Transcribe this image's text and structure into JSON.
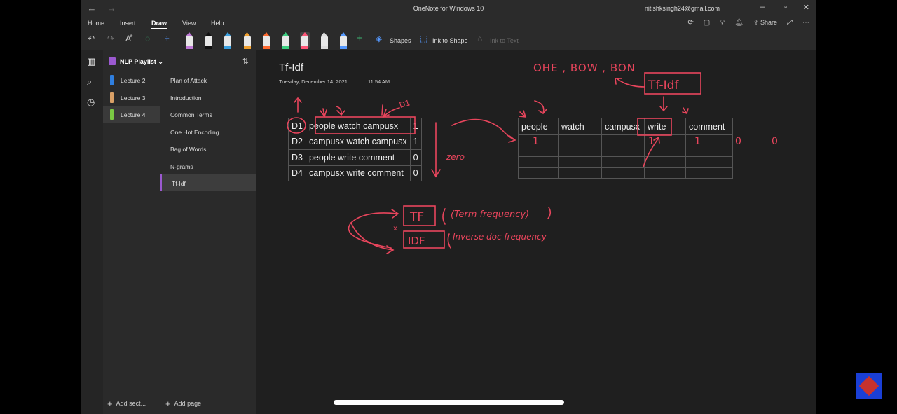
{
  "window": {
    "title": "OneNote for Windows 10",
    "user": "nitishksingh24@gmail.com",
    "back_icon": "back-arrow-icon",
    "forward_icon": "forward-arrow-icon"
  },
  "ribbon": {
    "tabs": [
      {
        "label": "Home",
        "active": false
      },
      {
        "label": "Insert",
        "active": false
      },
      {
        "label": "Draw",
        "active": true
      },
      {
        "label": "View",
        "active": false
      },
      {
        "label": "Help",
        "active": false
      }
    ],
    "share_label": "Share"
  },
  "toolbar": {
    "shapes_label": "Shapes",
    "ink_to_shape_label": "Ink to Shape",
    "ink_to_text_label": "Ink to Text",
    "pen_colors": [
      "#c07bd8",
      "#111111",
      "#3aa0e0",
      "#f0a030",
      "#ff6a30",
      "#3ccf80",
      "#ff5577",
      "#dddddd",
      "#5599ff"
    ]
  },
  "notebook": {
    "name": "NLP Playlist",
    "sections": [
      {
        "label": "Lecture 2",
        "color": "#2f7fe0",
        "active": false
      },
      {
        "label": "Lecture 3",
        "color": "#d9a066",
        "active": false
      },
      {
        "label": "Lecture 4",
        "color": "#7ac943",
        "active": true
      }
    ],
    "add_section_label": "Add sect...",
    "add_page_label": "Add page"
  },
  "pages": [
    {
      "label": "Plan of Attack",
      "active": false
    },
    {
      "label": "Introduction",
      "active": false
    },
    {
      "label": "Common Terms",
      "active": false
    },
    {
      "label": "One Hot Encoding",
      "active": false
    },
    {
      "label": "Bag of Words",
      "active": false
    },
    {
      "label": "N-grams",
      "active": false
    },
    {
      "label": "Tf-Idf",
      "active": true
    }
  ],
  "page": {
    "title": "Tf-Idf",
    "date": "Tuesday, December 14, 2021",
    "time": "11:54 AM"
  },
  "doc_table": [
    {
      "id": "D1",
      "text": "people watch campusx",
      "value": "1"
    },
    {
      "id": "D2",
      "text": "campusx watch campusx",
      "value": "1"
    },
    {
      "id": "D3",
      "text": "people write comment",
      "value": "0"
    },
    {
      "id": "D4",
      "text": "campusx write comment",
      "value": "0"
    }
  ],
  "vocab_table": {
    "headers": [
      "people",
      "watch",
      "campusx",
      "write",
      "comment"
    ],
    "rows": 3
  },
  "ink": {
    "methods": "OHE , BOW , BON",
    "tfidf_box": "Tf-Idf",
    "d1_note": "D1",
    "zero_note": "zero",
    "tf_box": "TF",
    "tf_text": "(Term frequency)",
    "idf_box": "IDF",
    "idf_text": "Inverse doc frequency",
    "x_mark": "x",
    "ones": [
      "1",
      "1",
      "1"
    ],
    "zeros": [
      "0",
      "0"
    ],
    "ink_color": "#e8455c"
  }
}
